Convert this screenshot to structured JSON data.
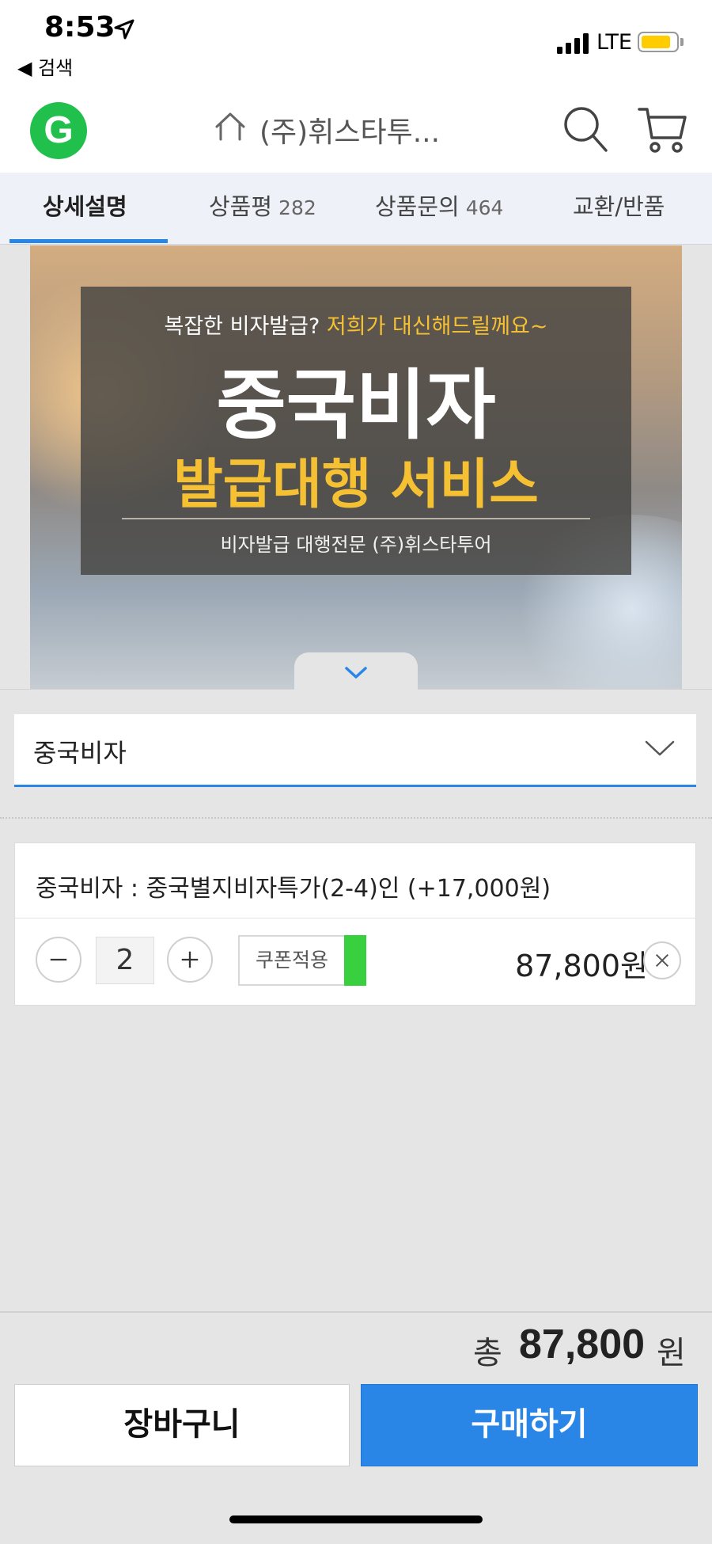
{
  "status_bar": {
    "time": "8:53",
    "back_label": "◀ 검색",
    "network": "LTE",
    "icons": [
      "location-arrow-icon",
      "signal-icon",
      "battery-icon"
    ],
    "battery_color": "#ffcc00"
  },
  "header": {
    "logo_letter": "G",
    "logo_color": "#21c04c",
    "shop_title": "(주)휘스타투...",
    "icons": [
      "home-icon",
      "search-icon",
      "cart-icon"
    ]
  },
  "tabs": [
    {
      "label": "상세설명",
      "count": "",
      "active": true
    },
    {
      "label": "상품평",
      "count": "282",
      "active": false
    },
    {
      "label": "상품문의",
      "count": "464",
      "active": false
    },
    {
      "label": "교환/반품",
      "count": "",
      "active": false
    }
  ],
  "banner": {
    "line1_plain": "복잡한 비자발급?",
    "line1_highlight": "저희가 대신해드릴께요~",
    "title": "중국비자",
    "subtitle": "발급대행 서비스",
    "footer": "비자발급 대행전문 (주)휘스타투어",
    "highlight_color": "#f6c033"
  },
  "option_select": {
    "value": "중국비자"
  },
  "selected_option": {
    "name": "중국비자 : 중국별지비자특가(2-4)인 (+17,000원)",
    "quantity": "2",
    "coupon_label": "쿠폰적용",
    "price": "87,800원"
  },
  "total": {
    "label": "총",
    "amount": "87,800",
    "unit": "원"
  },
  "buttons": {
    "cart": "장바구니",
    "buy": "구매하기"
  },
  "accent_color": "#2a86e6"
}
